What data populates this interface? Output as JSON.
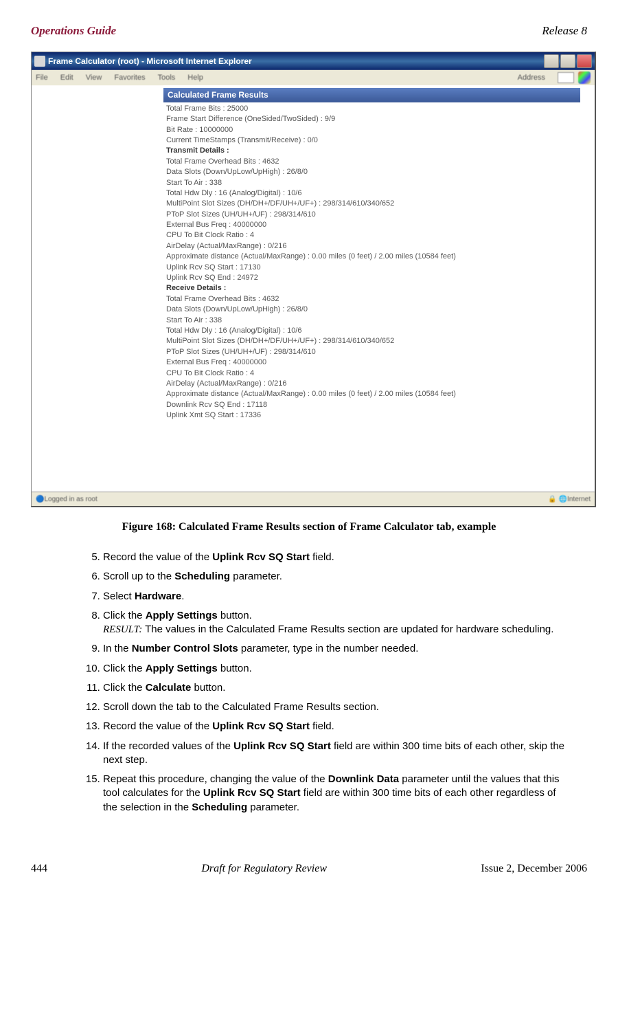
{
  "header": {
    "left": "Operations Guide",
    "right": "Release 8"
  },
  "screenshot": {
    "title": "Frame Calculator (root) - Microsoft Internet Explorer",
    "menu": [
      "File",
      "Edit",
      "View",
      "Favorites",
      "Tools",
      "Help"
    ],
    "address_label": "Address",
    "section_head": "Calculated Frame Results",
    "lines": [
      {
        "t": "Total Frame Bits : 25000",
        "b": false
      },
      {
        "t": "Frame Start Difference (OneSided/TwoSided) : 9/9",
        "b": false
      },
      {
        "t": "Bit Rate : 10000000",
        "b": false
      },
      {
        "t": "Current TimeStamps (Transmit/Receive) : 0/0",
        "b": false
      },
      {
        "t": "Transmit Details :",
        "b": true
      },
      {
        "t": "Total Frame Overhead Bits : 4632",
        "b": false
      },
      {
        "t": "Data Slots (Down/UpLow/UpHigh) : 26/8/0",
        "b": false
      },
      {
        "t": "Start To Air : 338",
        "b": false
      },
      {
        "t": "Total Hdw Dly : 16 (Analog/Digital) : 10/6",
        "b": false
      },
      {
        "t": "MultiPoint Slot Sizes (DH/DH+/DF/UH+/UF+) : 298/314/610/340/652",
        "b": false
      },
      {
        "t": "PToP Slot Sizes (UH/UH+/UF) : 298/314/610",
        "b": false
      },
      {
        "t": "External Bus Freq : 40000000",
        "b": false
      },
      {
        "t": "CPU To Bit Clock Ratio : 4",
        "b": false
      },
      {
        "t": "AirDelay (Actual/MaxRange) : 0/216",
        "b": false
      },
      {
        "t": "Approximate distance (Actual/MaxRange) : 0.00 miles (0 feet) / 2.00 miles (10584 feet)",
        "b": false
      },
      {
        "t": "Uplink Rcv SQ Start : 17130",
        "b": false
      },
      {
        "t": "Uplink Rcv SQ End : 24972",
        "b": false
      },
      {
        "t": "Receive Details :",
        "b": true
      },
      {
        "t": "Total Frame Overhead Bits : 4632",
        "b": false
      },
      {
        "t": "Data Slots (Down/UpLow/UpHigh) : 26/8/0",
        "b": false
      },
      {
        "t": "Start To Air : 338",
        "b": false
      },
      {
        "t": "Total Hdw Dly : 16 (Analog/Digital) : 10/6",
        "b": false
      },
      {
        "t": "MultiPoint Slot Sizes (DH/DH+/DF/UH+/UF+) : 298/314/610/340/652",
        "b": false
      },
      {
        "t": "PToP Slot Sizes (UH/UH+/UF) : 298/314/610",
        "b": false
      },
      {
        "t": "External Bus Freq : 40000000",
        "b": false
      },
      {
        "t": "CPU To Bit Clock Ratio : 4",
        "b": false
      },
      {
        "t": "AirDelay (Actual/MaxRange) : 0/216",
        "b": false
      },
      {
        "t": "Approximate distance (Actual/MaxRange) : 0.00 miles (0 feet) / 2.00 miles (10584 feet)",
        "b": false
      },
      {
        "t": "Downlink Rcv SQ End : 17118",
        "b": false
      },
      {
        "t": "Uplink Xmt SQ Start : 17336",
        "b": false
      }
    ],
    "status_left": "Logged in as root",
    "status_right": "Internet"
  },
  "figure_caption": "Figure 168: Calculated Frame Results section of Frame Calculator tab, example",
  "steps": [
    {
      "n": 5,
      "html": "Record the value of the <b>Uplink Rcv SQ Start</b> field."
    },
    {
      "n": 6,
      "html": "Scroll up to the <b>Scheduling</b> parameter."
    },
    {
      "n": 7,
      "html": "Select <b>Hardware</b>."
    },
    {
      "n": 8,
      "html": "Click the <b>Apply Settings</b> button.<br><span class='result'>RESULT:</span> The values in the Calculated Frame Results section are updated for hardware scheduling."
    },
    {
      "n": 9,
      "html": "In the <b>Number Control Slots</b> parameter, type in the number needed."
    },
    {
      "n": 10,
      "html": "Click the <b>Apply Settings</b> button."
    },
    {
      "n": 11,
      "html": "Click the <b>Calculate</b> button."
    },
    {
      "n": 12,
      "html": "Scroll down the tab to the Calculated Frame Results section."
    },
    {
      "n": 13,
      "html": "Record the value of the <b>Uplink Rcv SQ Start</b> field."
    },
    {
      "n": 14,
      "html": "If the recorded values of the <b>Uplink Rcv SQ Start</b> field are within 300 time bits of each other, skip the next step."
    },
    {
      "n": 15,
      "html": "Repeat this procedure, changing the value of the <b>Downlink Data</b> parameter until the values that this tool calculates for the <b>Uplink Rcv SQ Start</b> field are within 300 time bits of each other regardless of the selection in the <b>Scheduling</b> parameter."
    }
  ],
  "footer": {
    "left": "444",
    "center": "Draft for Regulatory Review",
    "right": "Issue 2, December 2006"
  }
}
